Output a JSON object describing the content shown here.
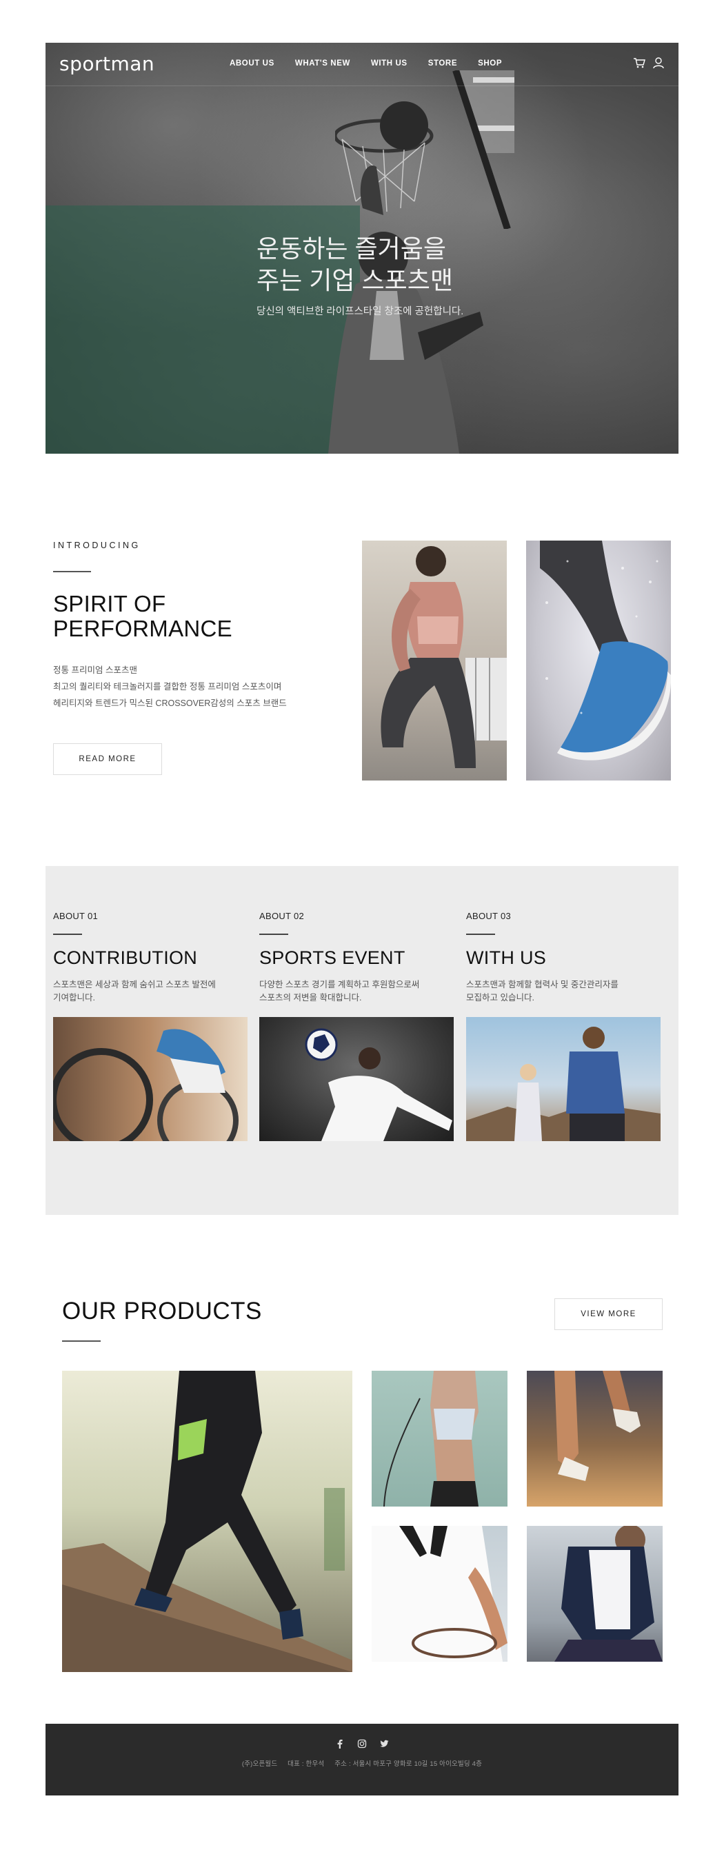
{
  "brand": {
    "logo": "sportman"
  },
  "nav": {
    "items": [
      "ABOUT US",
      "WHAT'S NEW",
      "WITH US",
      "STORE",
      "SHOP"
    ],
    "icons": [
      "cart-icon",
      "user-icon"
    ]
  },
  "hero": {
    "title_line1": "운동하는 즐거움을",
    "title_line2": "주는 기업 스포츠맨",
    "subtitle": "당신의 액티브한 라이프스타일 창조에 공헌합니다."
  },
  "intro": {
    "eyebrow": "INTRODUCING",
    "title_line1": "SPIRIT OF",
    "title_line2": "PERFORMANCE",
    "desc_line1": "정통 프리미엄 스포츠맨",
    "desc_line2": "최고의 퀄리티와 테크놀러지를 결합한 정통 프리미엄 스포츠이며",
    "desc_line3": "헤리티지와 트렌드가 믹스된 CROSSOVER감성의 스포츠 브랜드",
    "button": "READ MORE"
  },
  "about": {
    "items": [
      {
        "label": "ABOUT 01",
        "title": "CONTRIBUTION",
        "desc_line1": "스포츠맨은 세상과 함께 숨쉬고 스포츠 발전에",
        "desc_line2": "기여합니다."
      },
      {
        "label": "ABOUT 02",
        "title": "SPORTS EVENT",
        "desc_line1": "다양한 스포츠 경기를 계획하고 후원함으로써",
        "desc_line2": "스포츠의 저변을 확대합니다."
      },
      {
        "label": "ABOUT 03",
        "title": "WITH US",
        "desc_line1": "스포츠맨과 함께할 협력사 및 중간관리자를",
        "desc_line2": "모집하고 있습니다."
      }
    ]
  },
  "products": {
    "title": "OUR PRODUCTS",
    "button": "VIEW MORE"
  },
  "footer": {
    "icons": [
      "facebook-icon",
      "instagram-icon",
      "twitter-icon"
    ],
    "company": "(주)오픈월드",
    "ceo": "대표 : 한우석",
    "address": "주소 : 서울시 마포구 양화로 10길 15 아이오빌딩 4층"
  },
  "colors": {
    "hero_teal": "#2e604e",
    "about_bg": "#ececec",
    "footer_bg": "#2b2b2b"
  }
}
